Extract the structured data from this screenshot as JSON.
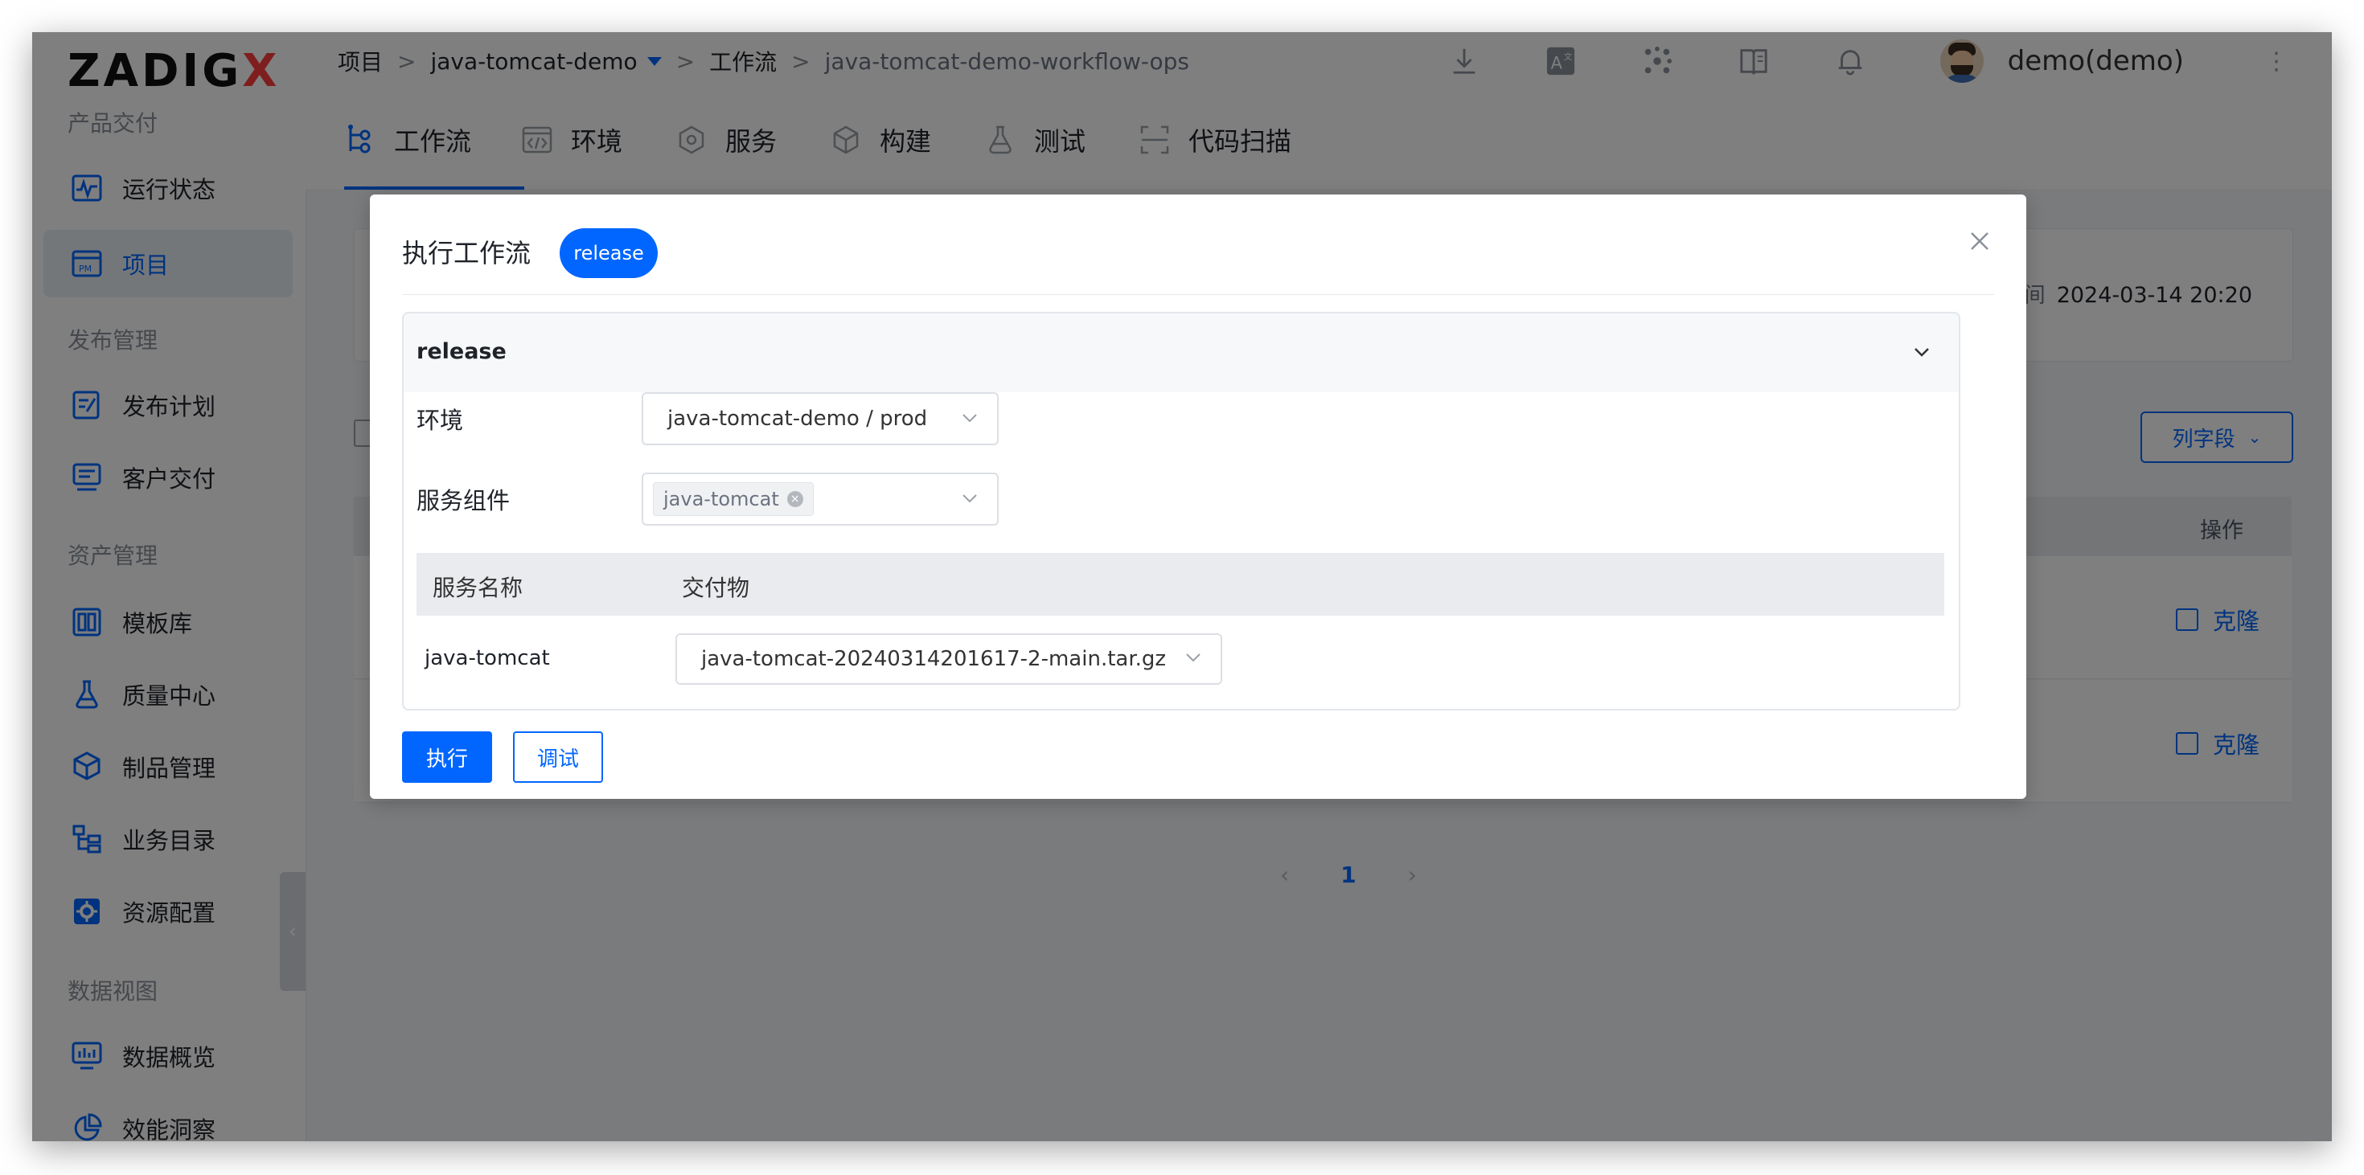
{
  "brand": {
    "logo_text": "ZADIG",
    "logo_x": "X"
  },
  "sidebar": {
    "sections": [
      {
        "title": "产品交付"
      },
      {
        "title": "发布管理"
      },
      {
        "title": "资产管理"
      },
      {
        "title": "数据视图"
      }
    ],
    "items": [
      {
        "label": "运行状态",
        "icon": "pulse-icon"
      },
      {
        "label": "项目",
        "icon": "project-icon",
        "active": true
      },
      {
        "label": "发布计划",
        "icon": "release-plan-icon"
      },
      {
        "label": "客户交付",
        "icon": "customer-delivery-icon"
      },
      {
        "label": "模板库",
        "icon": "template-icon"
      },
      {
        "label": "质量中心",
        "icon": "flask-icon"
      },
      {
        "label": "制品管理",
        "icon": "artifact-icon"
      },
      {
        "label": "业务目录",
        "icon": "catalog-icon"
      },
      {
        "label": "资源配置",
        "icon": "gear-icon"
      },
      {
        "label": "数据概览",
        "icon": "dashboard-icon"
      },
      {
        "label": "效能洞察",
        "icon": "pie-icon"
      }
    ],
    "collapse_glyph": "‹"
  },
  "breadcrumb": {
    "root": "项目",
    "project": "java-tomcat-demo",
    "section": "工作流",
    "current": "java-tomcat-demo-workflow-ops",
    "separator": ">"
  },
  "topbar": {
    "username": "demo(demo)",
    "kebab": "⋮",
    "icons": [
      "download-icon",
      "translate-icon",
      "plugin-icon",
      "docs-icon",
      "bell-icon"
    ]
  },
  "tabs": [
    {
      "label": "工作流",
      "icon": "workflow-icon",
      "active": true
    },
    {
      "label": "环境",
      "icon": "environment-icon"
    },
    {
      "label": "服务",
      "icon": "service-icon"
    },
    {
      "label": "构建",
      "icon": "build-icon"
    },
    {
      "label": "测试",
      "icon": "test-icon"
    },
    {
      "label": "代码扫描",
      "icon": "scan-icon"
    }
  ],
  "background": {
    "modified_label": "修改时间",
    "modified_value": "2024-03-14 20:20",
    "column_button": "列字段",
    "table_op_header": "操作",
    "clone_label": "克隆",
    "page_current": "1",
    "page_prev": "‹",
    "page_next": "›"
  },
  "modal": {
    "title": "执行工作流",
    "workflow_tag": "release",
    "panel_title": "release",
    "env_label": "环境",
    "env_value": "java-tomcat-demo / prod",
    "service_label": "服务组件",
    "service_tag": "java-tomcat",
    "tag_remove": "×",
    "table_headers": {
      "service_name": "服务名称",
      "deliverable": "交付物"
    },
    "rows": [
      {
        "service": "java-tomcat",
        "artifact": "java-tomcat-20240314201617-2-main.tar.gz"
      }
    ],
    "run_button": "执行",
    "debug_button": "调试"
  },
  "colors": {
    "accent": "#0066ff",
    "logo_x": "#ff3d3d"
  }
}
